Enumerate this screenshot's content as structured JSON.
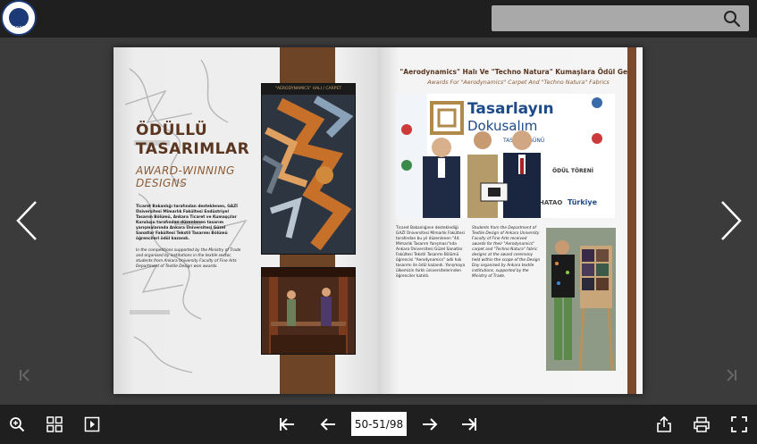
{
  "header": {
    "logo": {
      "text": "1936",
      "icon": "university-seal-icon"
    },
    "search": {
      "placeholder": "",
      "value": "",
      "icon": "search-icon"
    }
  },
  "viewer": {
    "nav": {
      "prev_icon": "chevron-left-icon",
      "next_icon": "chevron-right-icon",
      "first_icon": "first-page-icon",
      "last_icon": "last-page-icon"
    },
    "left_page": {
      "title_tr": "ÖDÜLLÜ TASARIMLAR",
      "title_line1": "ÖDÜLLÜ",
      "title_line2": "TASARIMLAR",
      "title_en_line1": "AWARD-WINNING",
      "title_en_line2": "DESIGNS",
      "carpet_label": "\"AERODYNAMICS\" HALI / CARPET",
      "para_tr": "Ticaret Bakanlığı tarafından desteklenen, GAZİ Üniversitesi Mimarlık Fakültesi Endüstriyel Tasarım Bölümü, Ankara Ticaret ve Kumaşçılar Kuruluşu tarafından düzenlenen tasarım yarışmalarında Ankara Üniversitesi Güzel Sanatlar Fakültesi Tekstil Tasarımı Bölümü öğrencileri ödül kazandı.",
      "para_en": "In the competitions supported by the Ministry of Trade and organised by institutions in the textile sector, students from Ankara University Faculty of Fine Arts Department of Textile Design won awards."
    },
    "right_page": {
      "title_tr": "\"Aerodynamics\" Halı Ve \"Techno Natura\" Kumaşlara Ödül Geldi",
      "title_en": "Awards For \"Aerodynamics\" Carpet And \"Techno Natura\" Fabrics",
      "banner_line1": "Tasarlayın",
      "banner_line2": "Dokusalım",
      "banner_line3": "TASARIM GÜNÜ",
      "banner_line4": "ÖDÜL TÖRENİ",
      "banner_brand1": "HATAO",
      "banner_brand2": "Türkiye",
      "col1": "Ticaret Bakanlığının desteklediği GAZİ Üniversitesi Mimarlık Fakültesi tarafından bu yıl düzenlenen \"44. Mimarlık Tasarım Yarışması\"nda Ankara Üniversitesi Güzel Sanatlar Fakültesi Tekstil Tasarımı Bölümü öğrencisi \"Aerodynamics\" adlı halı tasarımı ile ödül kazandı. Yarışmaya ülkemizin farklı üniversitelerinden öğrenciler katıldı.",
      "col2": "Students from the Department of Textile Design of Ankara University Faculty of Fine Arts received awards for their \"Aerodynamics\" carpet and \"Techno Natura\" fabric designs at the award ceremony held within the scope of the Design Day organised by Ankara textile institutions, supported by the Ministry of Trade."
    }
  },
  "toolbar": {
    "zoom_icon": "zoom-in-icon",
    "thumbnails_icon": "thumbnails-icon",
    "single_page_icon": "single-page-icon",
    "page_value": "50-51/98",
    "share_icon": "share-icon",
    "print_icon": "print-icon",
    "fullscreen_icon": "fullscreen-icon"
  }
}
